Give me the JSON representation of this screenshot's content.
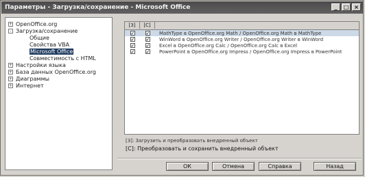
{
  "window": {
    "title": "Параметры - Загрузка/сохранение - Microsoft Office"
  },
  "tree": [
    {
      "label": "OpenOffice.org",
      "level": 0,
      "expander": "+"
    },
    {
      "label": "Загрузка/сохранение",
      "level": 0,
      "expander": "-"
    },
    {
      "label": "Общие",
      "level": 1
    },
    {
      "label": "Свойства VBA",
      "level": 1
    },
    {
      "label": "Microsoft Office",
      "level": 1,
      "selected": true
    },
    {
      "label": "Совместимость с HTML",
      "level": 1
    },
    {
      "label": "Настройки языка",
      "level": 0,
      "expander": "+"
    },
    {
      "label": "База данных OpenOffice.org",
      "level": 0,
      "expander": "+"
    },
    {
      "label": "Диаграммы",
      "level": 0,
      "expander": "+"
    },
    {
      "label": "Интернет",
      "level": 0,
      "expander": "+"
    }
  ],
  "grid": {
    "headers": [
      "[З]",
      "[С]"
    ],
    "rows": [
      {
        "load": true,
        "save": true,
        "text": "MathType в OpenOffice.org Math / OpenOffice.org Math в MathType",
        "selected": true
      },
      {
        "load": true,
        "save": true,
        "text": "WinWord в OpenOffice.org Writer / OpenOffice.org Writer в WinWord"
      },
      {
        "load": true,
        "save": true,
        "text": "Excel в OpenOffice.org Calc / OpenOffice.org Calc в Excel"
      },
      {
        "load": true,
        "save": true,
        "text": "PowerPoint в OpenOffice.org Impress / OpenOffice.org Impress в PowerPoint"
      }
    ]
  },
  "legend": {
    "load": "[З]: Загрузить и преобразовать внедренный объект",
    "save": "[С]: Преобразовать и сохранить внедренный объект"
  },
  "buttons": {
    "ok": "ОК",
    "cancel": "Отмена",
    "help": "Справка",
    "back": "Назад"
  }
}
